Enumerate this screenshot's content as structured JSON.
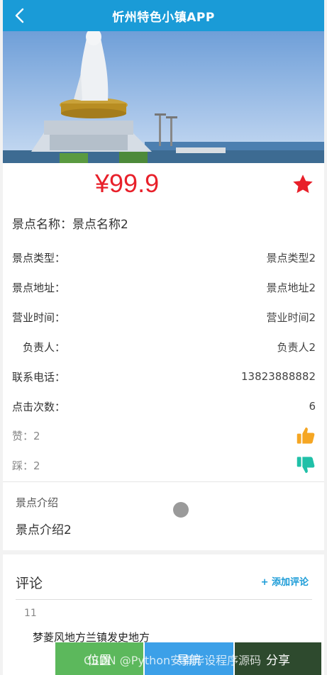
{
  "header": {
    "title": "忻州特色小镇APP"
  },
  "price": "¥99.9",
  "spot_name_line": "景点名称：景点名称2",
  "info": [
    {
      "label": "景点类型：",
      "value": "景点类型2"
    },
    {
      "label": "景点地址：",
      "value": "景点地址2"
    },
    {
      "label": "营业时间：",
      "value": "营业时间2"
    },
    {
      "label": "负责人：",
      "value": "负责人2"
    },
    {
      "label": "联系电话：",
      "value": "13823888882"
    },
    {
      "label": "点击次数：",
      "value": "6"
    }
  ],
  "votes": {
    "like_label": "赞：2",
    "dislike_label": "踩：2"
  },
  "intro": {
    "title": "景点介绍",
    "text": "景点介绍2"
  },
  "comments": {
    "title": "评论",
    "add_label": "+ 添加评论",
    "items": [
      {
        "user": "11",
        "text": "梦菱风地方兰镇发史地方"
      }
    ]
  },
  "bottom_bar": {
    "location_label": "位置",
    "navigate_label": "导航",
    "share_label": "分享"
  },
  "watermark": "CSDN @Python安卓毕设程序源码",
  "colors": {
    "header": "#1a9bd7",
    "price": "#e8202a",
    "like": "#f5a623",
    "dislike": "#20c0a8",
    "location_btn": "#5cb85c",
    "navigate_btn": "#3ca0e8",
    "share_btn": "#2e4a2e"
  },
  "icons": {
    "back": "chevron-left-icon",
    "favorite": "star-icon",
    "like": "thumbs-up-icon",
    "dislike": "thumbs-down-icon"
  }
}
